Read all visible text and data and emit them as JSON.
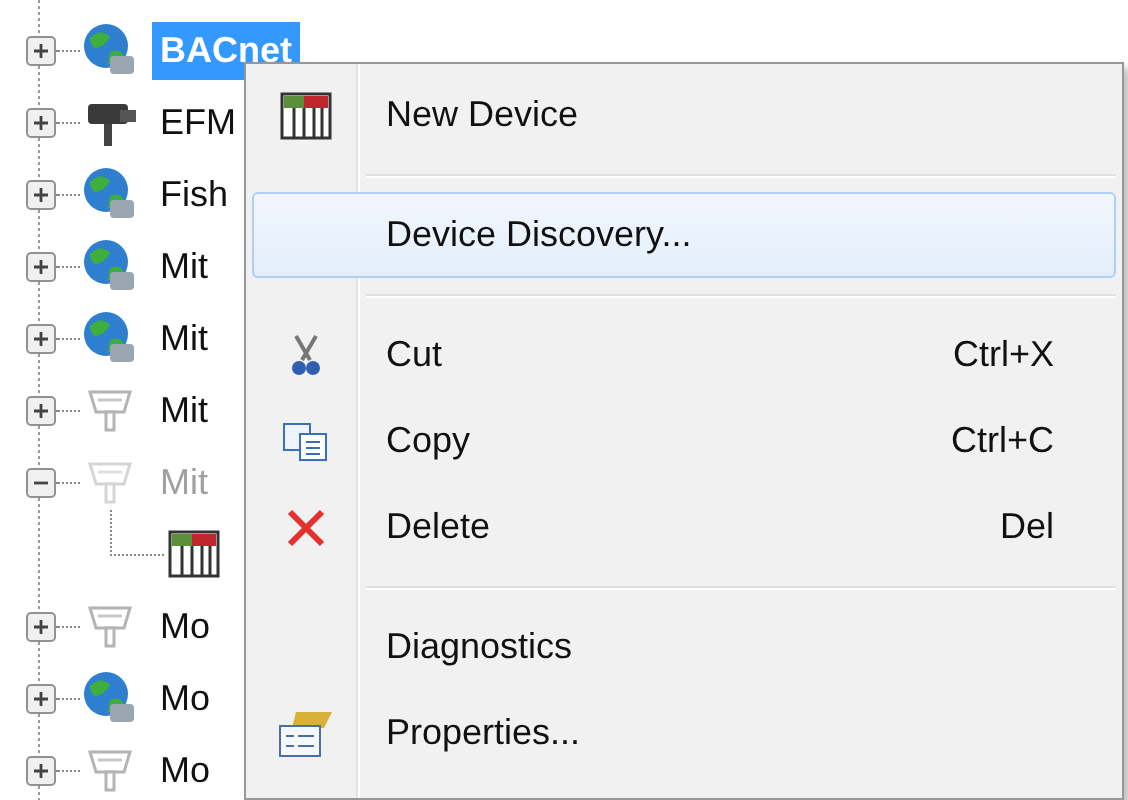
{
  "tree": {
    "items": [
      {
        "label": "BACnet",
        "kind": "globe",
        "expanded": false,
        "selected": true,
        "disabled": false
      },
      {
        "label": "EFM",
        "kind": "camera",
        "expanded": false,
        "selected": false,
        "disabled": false
      },
      {
        "label": "Fish",
        "kind": "globe",
        "expanded": false,
        "selected": false,
        "disabled": false
      },
      {
        "label": "Mit",
        "kind": "globe",
        "expanded": false,
        "selected": false,
        "disabled": false
      },
      {
        "label": "Mit",
        "kind": "globe",
        "expanded": false,
        "selected": false,
        "disabled": false
      },
      {
        "label": "Mit",
        "kind": "plug",
        "expanded": false,
        "selected": false,
        "disabled": false
      },
      {
        "label": "Mit",
        "kind": "plug",
        "expanded": true,
        "selected": false,
        "disabled": true,
        "children": [
          {
            "kind": "module",
            "selected": false
          }
        ]
      },
      {
        "label": "Mo",
        "kind": "plug",
        "expanded": false,
        "selected": false,
        "disabled": false
      },
      {
        "label": "Mo",
        "kind": "globe",
        "expanded": false,
        "selected": false,
        "disabled": false
      },
      {
        "label": "Mo",
        "kind": "plug",
        "expanded": false,
        "selected": false,
        "disabled": false
      }
    ]
  },
  "context_menu": {
    "groups": [
      [
        {
          "label": "New Device",
          "kind": "module",
          "selected": false
        }
      ],
      [
        {
          "label": "Device Discovery...",
          "kind": "plain",
          "selected": true
        }
      ],
      [
        {
          "label": "Cut",
          "shortcut": "Ctrl+X",
          "kind": "scissors",
          "selected": false
        },
        {
          "label": "Copy",
          "shortcut": "Ctrl+C",
          "kind": "copy",
          "selected": false
        },
        {
          "label": "Delete",
          "shortcut": "Del",
          "kind": "cross",
          "selected": false
        }
      ],
      [
        {
          "label": "Diagnostics",
          "kind": "plain",
          "selected": false
        },
        {
          "label": "Properties...",
          "kind": "card",
          "selected": false
        }
      ]
    ]
  }
}
